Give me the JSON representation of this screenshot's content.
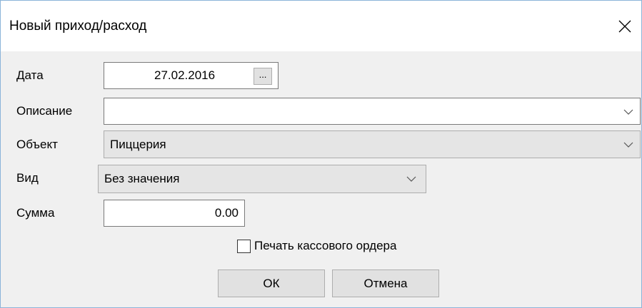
{
  "window": {
    "title": "Новый приход/расход"
  },
  "fields": {
    "date": {
      "label": "Дата",
      "value": "27.02.2016",
      "picker_button": "..."
    },
    "description": {
      "label": "Описание",
      "value": ""
    },
    "object": {
      "label": "Объект",
      "value": "Пиццерия"
    },
    "kind": {
      "label": "Вид",
      "value": "Без значения"
    },
    "amount": {
      "label": "Сумма",
      "value": "0.00"
    }
  },
  "print_order": {
    "label": "Печать кассового ордера",
    "checked": false
  },
  "buttons": {
    "ok": "ОК",
    "cancel": "Отмена"
  },
  "icons": {
    "close": "close-icon",
    "dropdown": "chevron-down-icon"
  },
  "colors": {
    "window_border": "#8bb4d9",
    "dialog_background": "#f0f0f0",
    "title_background": "#ffffff"
  }
}
